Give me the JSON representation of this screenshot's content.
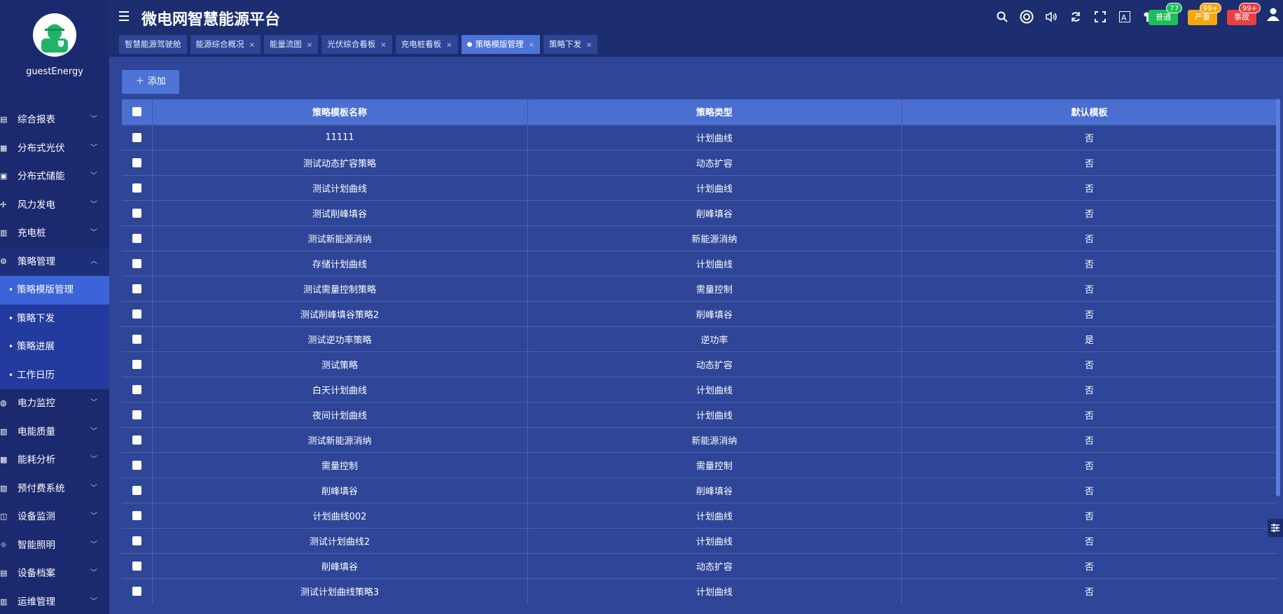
{
  "app": {
    "title": "微电网智慧能源平台"
  },
  "user": {
    "name": "guestEnergy"
  },
  "colors": {
    "sidebar": "#1b2a6e",
    "header": "#1c2d70",
    "main": "#2e4598",
    "accent": "#4d74d6",
    "alarm_normal": "#1cbf5a",
    "alarm_serious": "#f5a70c",
    "alarm_accident": "#e84040"
  },
  "tabs": [
    {
      "label": "智慧能源驾驶舱",
      "closable": false
    },
    {
      "label": "能源综合概况",
      "closable": true
    },
    {
      "label": "能量流图",
      "closable": true
    },
    {
      "label": "光伏综合看板",
      "closable": true
    },
    {
      "label": "充电桩看板",
      "closable": true
    },
    {
      "label": "策略模版管理",
      "closable": true,
      "active": true
    },
    {
      "label": "策略下发",
      "closable": true
    }
  ],
  "toolbar_icons": [
    "search-icon",
    "lifebuoy-icon",
    "volume-icon",
    "refresh-icon",
    "fullscreen-icon",
    "font-size-icon",
    "theme-shirt-icon"
  ],
  "alarms": [
    {
      "label": "普通",
      "count": "77"
    },
    {
      "label": "严重",
      "count": "99+"
    },
    {
      "label": "事故",
      "count": "99+"
    }
  ],
  "sidebar": {
    "items": [
      {
        "label": "综合报表",
        "icon": "report-icon"
      },
      {
        "label": "分布式光伏",
        "icon": "solar-panel-icon"
      },
      {
        "label": "分布式储能",
        "icon": "battery-icon"
      },
      {
        "label": "风力发电",
        "icon": "wind-turbine-icon"
      },
      {
        "label": "充电桩",
        "icon": "charging-pile-icon"
      },
      {
        "label": "策略管理",
        "icon": "strategy-icon",
        "open": true,
        "children": [
          {
            "label": "策略模版管理",
            "active": true
          },
          {
            "label": "策略下发"
          },
          {
            "label": "策略进展"
          },
          {
            "label": "工作日历"
          }
        ]
      },
      {
        "label": "电力监控",
        "icon": "power-monitor-icon"
      },
      {
        "label": "电能质量",
        "icon": "power-quality-icon"
      },
      {
        "label": "能耗分析",
        "icon": "energy-analysis-icon"
      },
      {
        "label": "预付费系统",
        "icon": "prepaid-icon"
      },
      {
        "label": "设备监测",
        "icon": "device-monitor-icon"
      },
      {
        "label": "智能照明",
        "icon": "lightbulb-icon"
      },
      {
        "label": "设备档案",
        "icon": "device-archive-icon"
      },
      {
        "label": "运维管理",
        "icon": "maintenance-icon"
      }
    ]
  },
  "main": {
    "add_button": "添加",
    "table": {
      "columns": [
        "策略模板名称",
        "策略类型",
        "默认模板"
      ],
      "rows": [
        [
          "11111",
          "计划曲线",
          "否"
        ],
        [
          "测试动态扩容策略",
          "动态扩容",
          "否"
        ],
        [
          "测试计划曲线",
          "计划曲线",
          "否"
        ],
        [
          "测试削峰填谷",
          "削峰填谷",
          "否"
        ],
        [
          "测试新能源消纳",
          "新能源消纳",
          "否"
        ],
        [
          "存储计划曲线",
          "计划曲线",
          "否"
        ],
        [
          "测试需量控制策略",
          "需量控制",
          "否"
        ],
        [
          "测试削峰填谷策略2",
          "削峰填谷",
          "否"
        ],
        [
          "测试逆功率策略",
          "逆功率",
          "是"
        ],
        [
          "测试策略",
          "动态扩容",
          "否"
        ],
        [
          "白天计划曲线",
          "计划曲线",
          "否"
        ],
        [
          "夜间计划曲线",
          "计划曲线",
          "否"
        ],
        [
          "测试新能源消纳",
          "新能源消纳",
          "否"
        ],
        [
          "需量控制",
          "需量控制",
          "否"
        ],
        [
          "削峰填谷",
          "削峰填谷",
          "否"
        ],
        [
          "计划曲线002",
          "计划曲线",
          "否"
        ],
        [
          "测试计划曲线2",
          "计划曲线",
          "否"
        ],
        [
          "削峰填谷",
          "动态扩容",
          "否"
        ],
        [
          "测试计划曲线策略3",
          "计划曲线",
          "否"
        ]
      ]
    }
  }
}
